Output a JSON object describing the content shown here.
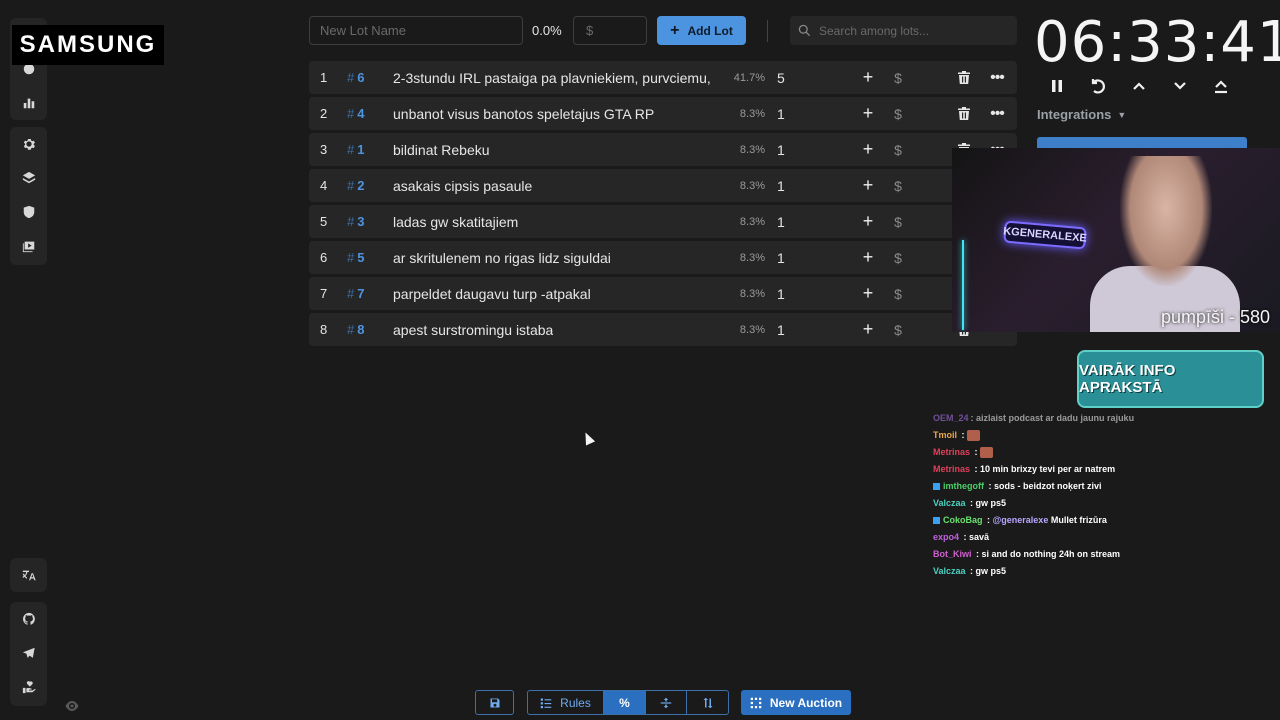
{
  "brand_overlay": "SAMSUNG",
  "toolbar": {
    "lot_name_placeholder": "New Lot Name",
    "percent": "0.0%",
    "amount_placeholder": "$",
    "add_lot_label": "Add Lot",
    "search_placeholder": "Search among lots..."
  },
  "lots": [
    {
      "index": "1",
      "fast_id": "6",
      "name": "2-3stundu IRL pastaiga pa plavniekiem, purvciemu,",
      "percent": "41.7%",
      "amount": "5"
    },
    {
      "index": "2",
      "fast_id": "4",
      "name": "unbanot visus banotos speletajus GTA RP",
      "percent": "8.3%",
      "amount": "1"
    },
    {
      "index": "3",
      "fast_id": "1",
      "name": "bildinat Rebeku",
      "percent": "8.3%",
      "amount": "1"
    },
    {
      "index": "4",
      "fast_id": "2",
      "name": "asakais cipsis pasaule",
      "percent": "8.3%",
      "amount": "1"
    },
    {
      "index": "5",
      "fast_id": "3",
      "name": "ladas gw skatitajiem",
      "percent": "8.3%",
      "amount": "1"
    },
    {
      "index": "6",
      "fast_id": "5",
      "name": "ar skritulenem no rigas lidz siguldai",
      "percent": "8.3%",
      "amount": "1"
    },
    {
      "index": "7",
      "fast_id": "7",
      "name": "parpeldet daugavu turp -atpakal",
      "percent": "8.3%",
      "amount": "1"
    },
    {
      "index": "8",
      "fast_id": "8",
      "name": "apest surstromingu istaba",
      "percent": "8.3%",
      "amount": "1"
    }
  ],
  "timer": {
    "value": "06:33:41",
    "integrations_label": "Integrations"
  },
  "stream": {
    "webcam_caption": "pumpīši - 580",
    "neon_sign": "KGENERALEXE",
    "info_banner": "VAIRĀK INFO APRAKSTĀ"
  },
  "chat": [
    {
      "user": "OEM_24",
      "user_color": "#b47cff",
      "text": ": aizlaist podcast ar dadu jaunu rajuku",
      "cut": true
    },
    {
      "user": "Tmoil",
      "user_color": "#e8a74a",
      "text": " :",
      "emote": true
    },
    {
      "user": "Metrinas",
      "user_color": "#e0405a",
      "text": " :",
      "emote": true
    },
    {
      "user": "Metrinas",
      "user_color": "#e0405a",
      "text": " : 10 min brixzy tevi per ar natrem"
    },
    {
      "user": "imthegoff",
      "user_color": "#4ad06a",
      "text": " : sods - beidzot noķert zivi",
      "badge": true
    },
    {
      "user": "Valczaa",
      "user_color": "#4ad0c0",
      "text": " : gw ps5"
    },
    {
      "user": "CokoBag",
      "user_color": "#6ae070",
      "text": " : ",
      "mention": "@generalexe",
      "after": " Mullet frizūra",
      "badge": true
    },
    {
      "user": "expo4",
      "user_color": "#c060e0",
      "text": " : savā"
    },
    {
      "user": "Bot_Kiwi",
      "user_color": "#d060d0",
      "text": " : si and do nothing 24h on stream"
    },
    {
      "user": "Valczaa",
      "user_color": "#4ad0c0",
      "text": " : gw ps5"
    }
  ],
  "bottom": {
    "rules_label": "Rules",
    "new_auction_label": "New Auction"
  },
  "colors": {
    "accent": "#4d94e0",
    "background": "#1a1a1a",
    "row": "#262626"
  }
}
